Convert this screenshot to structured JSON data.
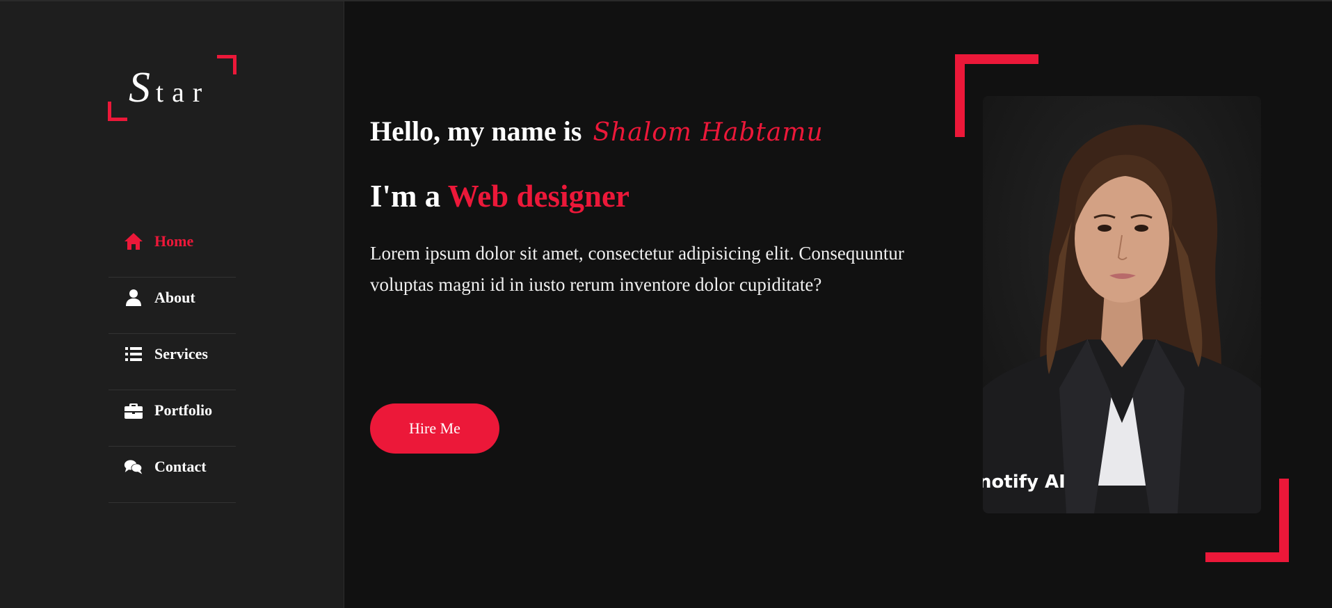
{
  "logo": {
    "first_letter": "S",
    "rest": "tar"
  },
  "nav": {
    "items": [
      {
        "label": "Home",
        "icon": "home-icon",
        "active": true
      },
      {
        "label": "About",
        "icon": "user-icon",
        "active": false
      },
      {
        "label": "Services",
        "icon": "list-icon",
        "active": false
      },
      {
        "label": "Portfolio",
        "icon": "briefcase-icon",
        "active": false
      },
      {
        "label": "Contact",
        "icon": "comments-icon",
        "active": false
      }
    ]
  },
  "hero": {
    "greeting": "Hello, my name is",
    "name": "Shalom Habtamu",
    "role_prefix": "I'm a",
    "role": "Web designer",
    "description": "Lorem ipsum dolor sit amet, consectetur adipisicing elit. Consequuntur voluptas magni id in iusto rerum inventore dolor cupiditate?",
    "cta_label": "Hire Me"
  },
  "portrait": {
    "watermark": "notify AI"
  },
  "colors": {
    "accent": "#ec1839",
    "background": "#111111",
    "sidebar": "#1e1e1e"
  }
}
